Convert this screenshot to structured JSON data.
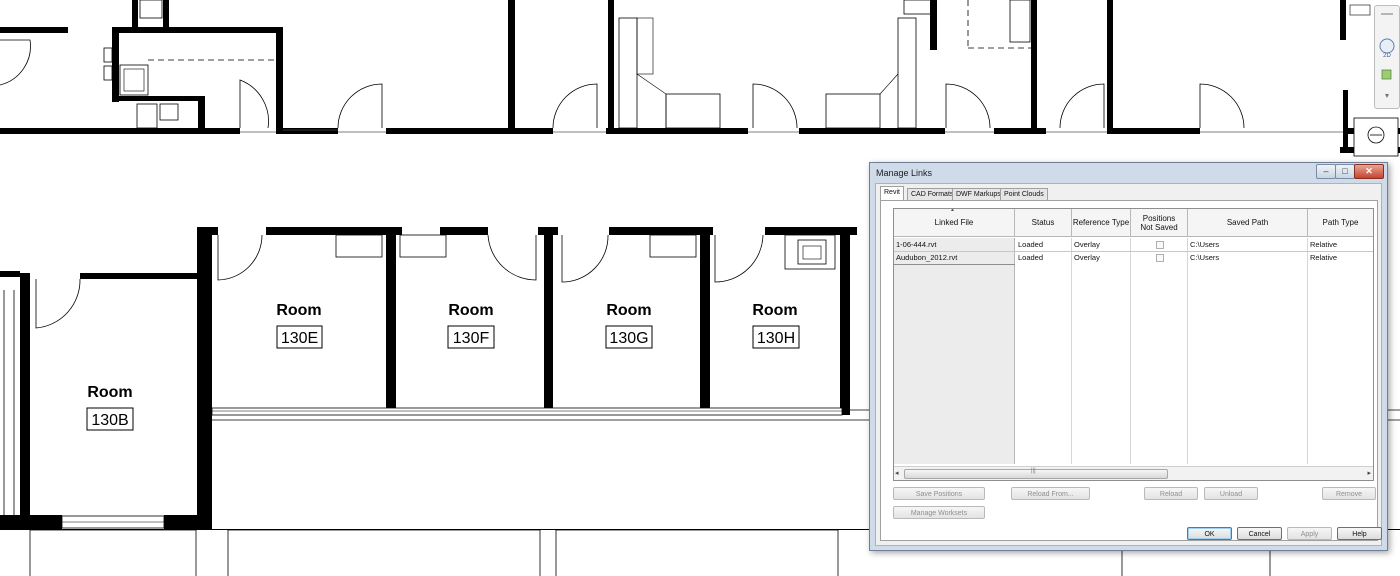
{
  "rooms": [
    {
      "name": "Room",
      "number": "130E"
    },
    {
      "name": "Room",
      "number": "130F"
    },
    {
      "name": "Room",
      "number": "130G"
    },
    {
      "name": "Room",
      "number": "130H"
    },
    {
      "name": "Room",
      "number": "130B"
    }
  ],
  "dialog": {
    "title": "Manage Links",
    "window_buttons": {
      "minimize": "–",
      "maximize": "□",
      "close": "✕"
    },
    "tabs": [
      "Revit",
      "CAD Formats",
      "DWF Markups",
      "Point Clouds"
    ],
    "active_tab": "Revit",
    "sort_indicator": "▲",
    "columns": [
      "Linked File",
      "Status",
      "Reference Type",
      "Positions Not Saved",
      "Saved Path",
      "Path Type"
    ],
    "rows": [
      {
        "file": "1-06-444.rvt",
        "status": "Loaded",
        "reference_type": "Overlay",
        "positions_not_saved": false,
        "saved_path": "C:\\Users",
        "path_type": "Relative"
      },
      {
        "file": "Audubon_2012.rvt",
        "status": "Loaded",
        "reference_type": "Overlay",
        "positions_not_saved": false,
        "saved_path": "C:\\Users",
        "path_type": "Relative"
      }
    ],
    "scroll_left": "◂",
    "scroll_right": "▸",
    "scroll_grip": "|||",
    "buttons": {
      "save_positions": "Save Positions",
      "reload_from": "Reload From...",
      "reload": "Reload",
      "unload": "Unload",
      "remove": "Remove",
      "manage_worksets": "Manage Worksets",
      "ok": "OK",
      "cancel": "Cancel",
      "apply": "Apply",
      "help": "Help"
    }
  },
  "navigation_bar": {
    "label_2d": "2D"
  }
}
